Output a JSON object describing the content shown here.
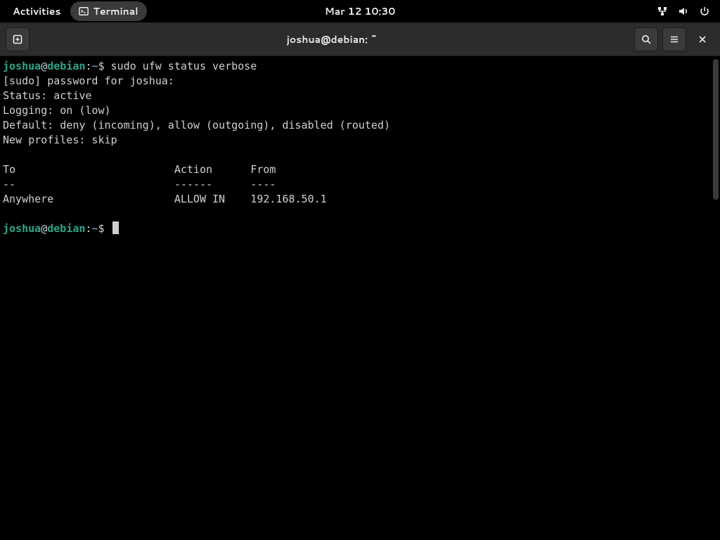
{
  "topbar": {
    "activities": "Activities",
    "app_name": "Terminal",
    "clock": "Mar 12  10:30"
  },
  "titlebar": {
    "title": "joshua@debian: ~"
  },
  "prompt": {
    "user": "joshua",
    "at": "@",
    "host": "debian",
    "colon": ":",
    "path": "~",
    "dollar": "$ "
  },
  "session": {
    "command1": "sudo ufw status verbose",
    "line_sudo_pw": "[sudo] password for joshua: ",
    "line_status": "Status: active",
    "line_logging": "Logging: on (low)",
    "line_default": "Default: deny (incoming), allow (outgoing), disabled (routed)",
    "line_newprofiles": "New profiles: skip",
    "tbl_header": "To                         Action      From",
    "tbl_divider": "--                         ------      ----",
    "tbl_row1": "Anywhere                   ALLOW IN    192.168.50.1               "
  }
}
